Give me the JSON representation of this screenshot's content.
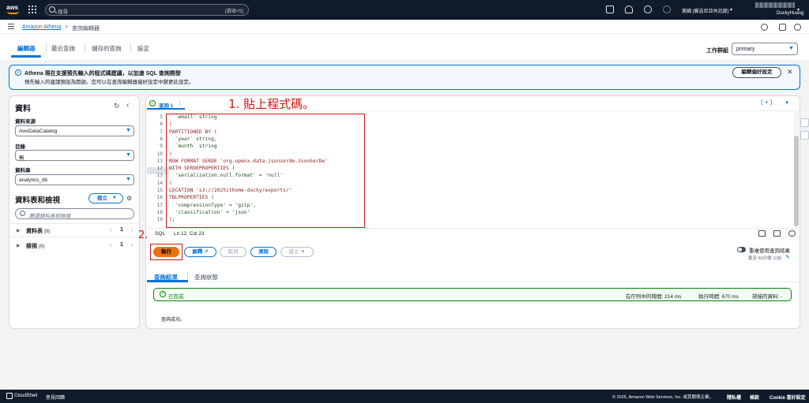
{
  "topnav": {
    "logo": "aws",
    "search_placeholder": "搜尋",
    "search_shortcut": "[選項+S]",
    "region": "美國 (維吉尼亞州北部)",
    "user": "DuckyHuang",
    "icons": [
      "grid-icon",
      "cloudshell-icon",
      "bell-icon",
      "help-icon",
      "gear-icon"
    ]
  },
  "breadcrumb": {
    "home": "Amazon Athena",
    "separator": ">",
    "current": "查詢編輯器"
  },
  "tabs": {
    "items": [
      "編輯器",
      "最近查詢",
      "儲存的查詢",
      "設定"
    ],
    "active": "編輯器"
  },
  "workgroup": {
    "label": "工作群組",
    "value": "primary"
  },
  "banner": {
    "title": "Athena 現在支援預先輸入的程式碼建議，以加速 SQL 查詢開發",
    "description": "預先輸入的建議預設為開啟。您可以在查詢編輯器偏好設定中變更此設定。",
    "button": "編輯偏好設定",
    "close": "✕"
  },
  "left_panel": {
    "title": "資料",
    "data_source_label": "資料來源",
    "data_source_value": "AwsDataCatalog",
    "catalog_label": "目錄",
    "catalog_value": "無",
    "database_label": "資料庫",
    "database_value": "analytics_db",
    "tables_views_title": "資料表和檢視",
    "create_button": "建立",
    "search_placeholder": "篩選資料表和檢視",
    "tree": [
      {
        "label": "資料表",
        "count": "(0)",
        "page": "1"
      },
      {
        "label": "檢視",
        "count": "(0)",
        "page": "1"
      }
    ]
  },
  "editor": {
    "query_tab": "查詢 1",
    "add_label": "( + )",
    "annotation_1": "1. 貼上程式碼。",
    "annotation_2": "2.",
    "highlight_line": "12",
    "lines": [
      {
        "n": "5",
        "code": "  `email` string",
        "kind": "str"
      },
      {
        "n": "6",
        "code": ")",
        "kind": "kw"
      },
      {
        "n": "7",
        "code": "PARTITIONED BY (",
        "kind": "kw"
      },
      {
        "n": "8",
        "code": "  `year` string,",
        "kind": "str"
      },
      {
        "n": "9",
        "code": "  `month` string",
        "kind": "str"
      },
      {
        "n": "10",
        "code": ")",
        "kind": "kw"
      },
      {
        "n": "11",
        "code": "ROW FORMAT SERDE 'org.openx.data.jsonserde.JsonSerDe'",
        "kind": "kw"
      },
      {
        "n": "12",
        "code": "WITH SERDEPROPERTIES (",
        "kind": "kw"
      },
      {
        "n": "13",
        "code": "  'serialization.null.format' = 'null'",
        "kind": "str"
      },
      {
        "n": "14",
        "code": ")",
        "kind": "kw"
      },
      {
        "n": "15",
        "code": "LOCATION 's3://2025ithome-ducky/exports/'",
        "kind": "kw"
      },
      {
        "n": "16",
        "code": "TBLPROPERTIES (",
        "kind": "kw"
      },
      {
        "n": "17",
        "code": "  'compressionType' = 'gzip',",
        "kind": "str"
      },
      {
        "n": "18",
        "code": "  'classification' = 'json'",
        "kind": "str"
      },
      {
        "n": "19",
        "code": ");",
        "kind": "kw"
      }
    ],
    "status_lang": "SQL",
    "status_pos": "Ln 12, Col 23",
    "buttons": {
      "run": "執行",
      "explain": "解釋",
      "cancel": "取消",
      "clear": "清除",
      "create": "建立"
    },
    "reuse_label": "重複使用查詢結果",
    "reuse_sub": "截至 60分鐘 以前"
  },
  "results": {
    "tab_results": "查詢結果",
    "tab_status": "查詢狀態",
    "status": "已完成",
    "queue_time": "在佇列中的時間: 214 ms",
    "exec_time": "執行時間: 670 ms",
    "scanned": "掃描的資料: -",
    "message": "查詢成功。"
  },
  "footer": {
    "cloudshell": "CloudShell",
    "feedback": "意見回饋",
    "copyright": "© 2025, Amazon Web Services, Inc. 或其關係企業。",
    "privacy": "隱私權",
    "terms": "條款",
    "cookie": "Cookie 喜好設定"
  }
}
